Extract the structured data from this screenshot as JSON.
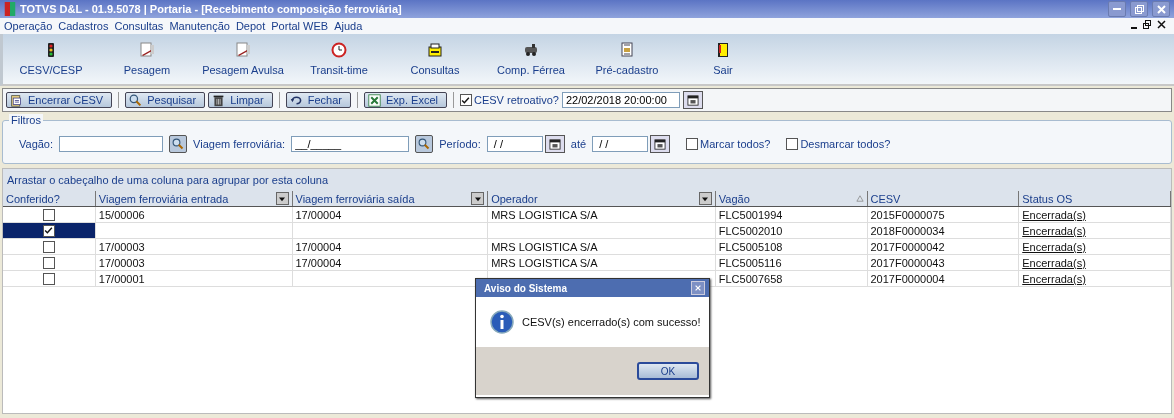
{
  "window": {
    "title": "TOTVS D&L - 01.9.5078 | Portaria - [Recebimento composição ferroviária]"
  },
  "menu": [
    "Operação",
    "Cadastros",
    "Consultas",
    "Manutenção",
    "Depot",
    "Portal WEB",
    "Ajuda"
  ],
  "toolbar": [
    "CESV/CESP",
    "Pesagem",
    "Pesagem Avulsa",
    "Transit-time",
    "Consultas",
    "Comp. Férrea",
    "Pré-cadastro",
    "Sair"
  ],
  "actions": [
    "Encerrar CESV",
    "Pesquisar",
    "Limpar",
    "Fechar",
    "Exp. Excel"
  ],
  "retroativo": {
    "label": "CESV retroativo?",
    "checked": true,
    "value": "22/02/2018 20:00:00"
  },
  "filters": {
    "title": "Filtros",
    "vagao_label": "Vagão:",
    "viagem_label": "Viagem ferroviária:",
    "viagem_value": "__/_____",
    "periodo_label": "Período:",
    "periodo_from": " / /",
    "ate_label": "até",
    "periodo_to": " / /",
    "marcar": {
      "label": "Marcar todos?",
      "checked": false
    },
    "desmarcar": {
      "label": "Desmarcar todos?",
      "checked": false
    }
  },
  "group_hint": "Arrastar o cabeçalho de uma coluna para agrupar por esta coluna",
  "table": {
    "columns": [
      {
        "label": "Conferido?",
        "kind": "plain"
      },
      {
        "label": "Viagem ferroviária entrada",
        "kind": "filter"
      },
      {
        "label": "Viagem ferroviária saída",
        "kind": "filter"
      },
      {
        "label": "Operador",
        "kind": "filter"
      },
      {
        "label": "Vagão",
        "kind": "sort"
      },
      {
        "label": "CESV",
        "kind": "plain"
      },
      {
        "label": "Status OS",
        "kind": "plain"
      }
    ],
    "rows": [
      {
        "checked": false,
        "selected": false,
        "cells": [
          "",
          "15/00006",
          "17/00004",
          "MRS LOGISTICA S/A",
          "FLC5001994",
          "2015F0000075",
          "Encerrada(s)"
        ]
      },
      {
        "checked": true,
        "selected": true,
        "cells": [
          "",
          "",
          "",
          "",
          "FLC5002010",
          "2018F0000034",
          "Encerrada(s)"
        ]
      },
      {
        "checked": false,
        "selected": false,
        "cells": [
          "",
          "17/00003",
          "17/00004",
          "MRS LOGISTICA S/A",
          "FLC5005108",
          "2017F0000042",
          "Encerrada(s)"
        ]
      },
      {
        "checked": false,
        "selected": false,
        "cells": [
          "",
          "17/00003",
          "17/00004",
          "MRS LOGISTICA S/A",
          "FLC5005116",
          "2017F0000043",
          "Encerrada(s)"
        ]
      },
      {
        "checked": false,
        "selected": false,
        "cells": [
          "",
          "17/00001",
          "",
          "",
          "FLC5007658",
          "2017F0000004",
          "Encerrada(s)"
        ]
      }
    ]
  },
  "dialog": {
    "title": "Aviso do Sistema",
    "message": "CESV(s) encerrado(s) com sucesso!",
    "button": "OK"
  }
}
